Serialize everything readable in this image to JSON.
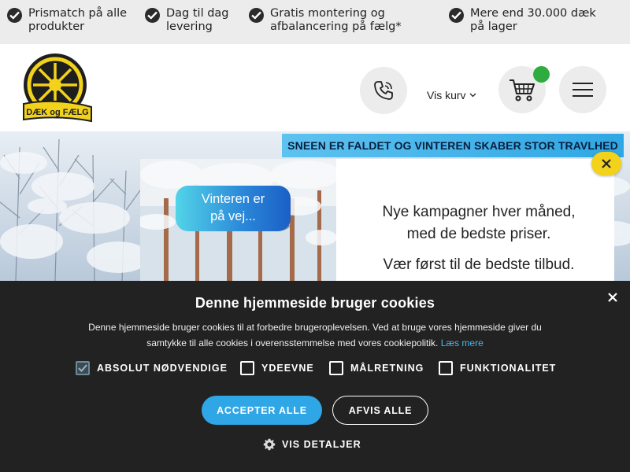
{
  "usp": [
    {
      "text_line1": "Prismatch på alle",
      "text_line2": "produkter"
    },
    {
      "text_line1": "Dag til dag",
      "text_line2": "levering"
    },
    {
      "text_line1": "Gratis montering og",
      "text_line2": "afbalancering på fælg*"
    },
    {
      "text_line1": "Mere end 30.000 dæk",
      "text_line2": "på lager"
    }
  ],
  "header": {
    "logo_text": "DÆK og FÆLG",
    "cart_label": "Vis kurv"
  },
  "hero": {
    "banner": "SNEEN ER FALDET OG VINTEREN SKABER STOR TRAVLHED",
    "pill_line1": "Vinteren er",
    "pill_line2": "på vej...",
    "promo_line1": "Nye kampagner hver måned,",
    "promo_line2": "med de bedste priser.",
    "promo_line3": "Vær først til de bedste tilbud."
  },
  "cookie": {
    "title": "Denne hjemmeside bruger cookies",
    "desc_line1": "Denne hjemmeside bruger cookies til at forbedre brugeroplevelsen. Ved at bruge vores hjemmeside giver du",
    "desc_line2": "samtykke til alle cookies i overensstemmelse med vores cookiepolitik.",
    "learn_more": "Læs mere",
    "options": [
      {
        "label": "ABSOLUT NØDVENDIGE",
        "checked": true
      },
      {
        "label": "YDEEVNE",
        "checked": false
      },
      {
        "label": "MÅLRETNING",
        "checked": false
      },
      {
        "label": "FUNKTIONALITET",
        "checked": false
      }
    ],
    "accept": "ACCEPTER ALLE",
    "reject": "AFVIS ALLE",
    "details": "VIS DETALJER"
  },
  "colors": {
    "accent_yellow": "#f2d21a",
    "accent_blue": "#2fa6e6",
    "cart_badge": "#2eac3f",
    "overlay_bg": "#222222"
  }
}
